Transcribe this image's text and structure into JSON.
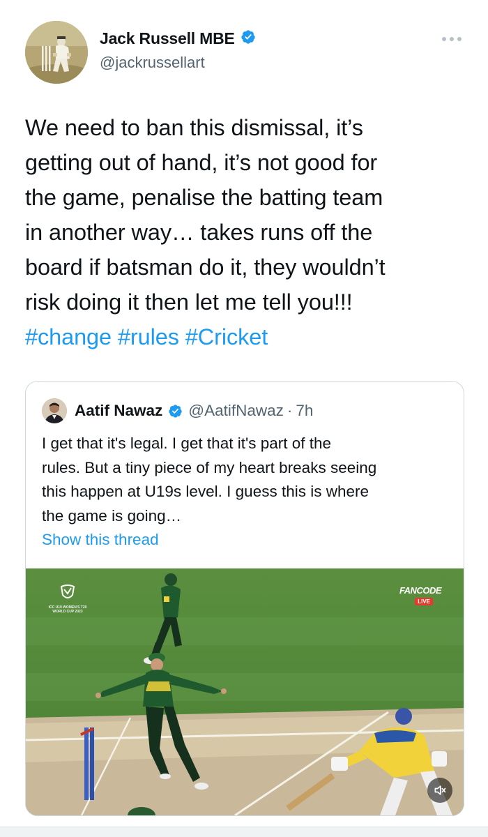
{
  "tweet": {
    "author": {
      "name": "Jack Russell MBE",
      "handle": "@jackrussellart",
      "verified": true
    },
    "text_lines": [
      "We need to ban this dismissal, it’s",
      "getting out of hand, it’s not good for",
      "the game, penalise the batting team",
      "in another way… takes runs off the",
      "board if batsman do it, they wouldn’t",
      "risk doing it then let me tell you!!!"
    ],
    "hashtags": [
      "#change",
      "#rules",
      "#Cricket"
    ]
  },
  "quote": {
    "author": {
      "name": "Aatif Nawaz",
      "handle": "@AatifNawaz",
      "separator": "·",
      "time": "7h",
      "verified": true
    },
    "text_lines": [
      "I get that it's legal. I get that it's part of the",
      "rules. But a tiny piece of my heart breaks seeing",
      "this happen at U19s level. I guess this is where",
      "the game is going…"
    ],
    "show_thread": "Show this thread",
    "media": {
      "watermark_text": "ICC U19 WOMEN'S T20 WORLD CUP 2023",
      "broadcaster": "FANCODE",
      "live_label": "LIVE",
      "mute_icon": "speaker-muted-icon"
    }
  },
  "colors": {
    "link": "#1d9bf0",
    "verified": "#1d9bf0",
    "secondary_text": "#536471",
    "border": "#cfd9de",
    "pitch_grass": "#4f8a3a",
    "kit_green": "#1f5a2e",
    "kit_yellow": "#f1d23a"
  }
}
